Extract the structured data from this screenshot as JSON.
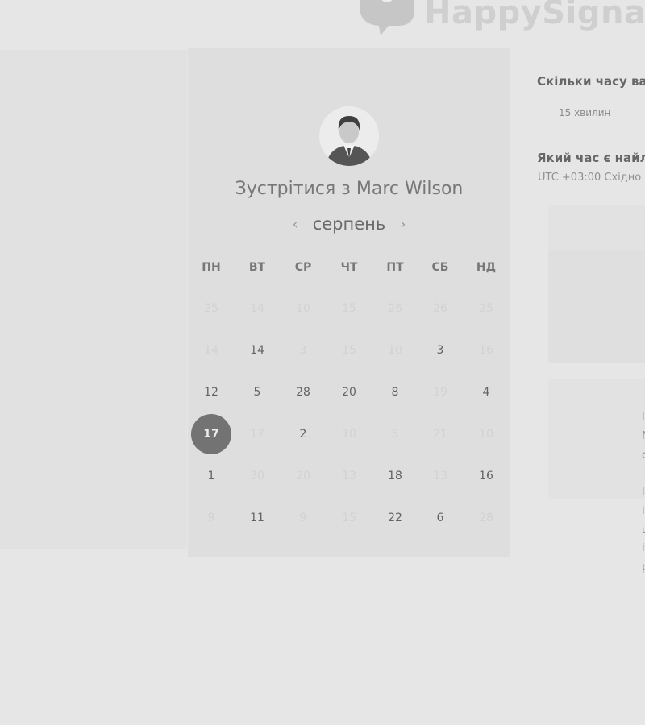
{
  "header": {
    "logo_text": "HappySignal",
    "logo_icon": "speech-bubble-heart-icon"
  },
  "calendar": {
    "title_prefix": "Зустрітися з",
    "host_name": "Marc Wilson",
    "avatar_icon": "user-avatar-icon",
    "month": "серпень",
    "prev_label": "‹",
    "next_label": "›",
    "weekdays": [
      "ПН",
      "ВТ",
      "СР",
      "ЧТ",
      "ПТ",
      "СБ",
      "НД"
    ],
    "rows": [
      [
        {
          "n": "25",
          "a": false
        },
        {
          "n": "14",
          "a": false
        },
        {
          "n": "10",
          "a": false
        },
        {
          "n": "15",
          "a": false
        },
        {
          "n": "26",
          "a": false
        },
        {
          "n": "26",
          "a": false
        },
        {
          "n": "25",
          "a": false
        }
      ],
      [
        {
          "n": "14",
          "a": false
        },
        {
          "n": "14",
          "a": true
        },
        {
          "n": "3",
          "a": false
        },
        {
          "n": "15",
          "a": false
        },
        {
          "n": "10",
          "a": false
        },
        {
          "n": "3",
          "a": true
        },
        {
          "n": "16",
          "a": false
        }
      ],
      [
        {
          "n": "12",
          "a": true
        },
        {
          "n": "5",
          "a": true
        },
        {
          "n": "28",
          "a": true
        },
        {
          "n": "20",
          "a": true
        },
        {
          "n": "8",
          "a": true
        },
        {
          "n": "19",
          "a": false
        },
        {
          "n": "4",
          "a": true
        }
      ],
      [
        {
          "n": "17",
          "a": true,
          "s": true
        },
        {
          "n": "17",
          "a": false
        },
        {
          "n": "2",
          "a": true
        },
        {
          "n": "10",
          "a": false
        },
        {
          "n": "5",
          "a": false
        },
        {
          "n": "21",
          "a": false
        },
        {
          "n": "10",
          "a": false
        }
      ],
      [
        {
          "n": "1",
          "a": true
        },
        {
          "n": "30",
          "a": false
        },
        {
          "n": "20",
          "a": false
        },
        {
          "n": "13",
          "a": false
        },
        {
          "n": "18",
          "a": true
        },
        {
          "n": "13",
          "a": false
        },
        {
          "n": "16",
          "a": true
        }
      ],
      [
        {
          "n": "9",
          "a": false
        },
        {
          "n": "11",
          "a": true
        },
        {
          "n": "9",
          "a": false
        },
        {
          "n": "15",
          "a": false
        },
        {
          "n": "22",
          "a": true
        },
        {
          "n": "6",
          "a": true
        },
        {
          "n": "28",
          "a": false
        }
      ]
    ]
  },
  "details": {
    "duration_question": "Скільки часу вам",
    "duration_value": "15 хвилин",
    "time_question": "Який час є найлі",
    "timezone_value": "UTC +03:00 Східно",
    "cut_text": [
      "l",
      "N",
      "c",
      "l",
      "i",
      "u",
      "i",
      "p"
    ]
  },
  "colors": {
    "background": "#e6e6e6",
    "panel": "#dedede",
    "selected_day": "#737373"
  }
}
